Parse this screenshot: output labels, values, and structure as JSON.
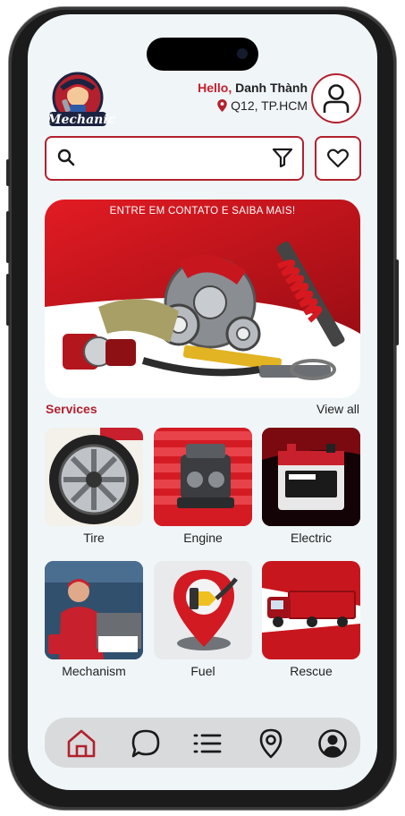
{
  "header": {
    "greeting_prefix": "Hello,",
    "user_name": "Danh Thành",
    "location": "Q12, TP.HCM",
    "logo_text": "Mechanic"
  },
  "search": {
    "value": "",
    "placeholder": ""
  },
  "banner": {
    "caption": "ENTRE EM CONTATO E SAIBA MAIS!"
  },
  "services": {
    "title": "Services",
    "view_all": "View all",
    "items": [
      {
        "label": "Tire",
        "icon": "tire-image"
      },
      {
        "label": "Engine",
        "icon": "engine-image"
      },
      {
        "label": "Electric",
        "icon": "battery-image"
      },
      {
        "label": "Mechanism",
        "icon": "mechanic-image"
      },
      {
        "label": "Fuel",
        "icon": "fuel-pump-image"
      },
      {
        "label": "Rescue",
        "icon": "truck-image"
      }
    ]
  },
  "bottom_nav": {
    "items": [
      {
        "name": "home-icon",
        "active": true
      },
      {
        "name": "chat-icon",
        "active": false
      },
      {
        "name": "list-icon",
        "active": false
      },
      {
        "name": "map-pin-icon",
        "active": false
      },
      {
        "name": "profile-icon",
        "active": false
      }
    ]
  },
  "colors": {
    "accent": "#b2212d",
    "background": "#f0f5f8",
    "nav_bg": "#d9dadc"
  }
}
